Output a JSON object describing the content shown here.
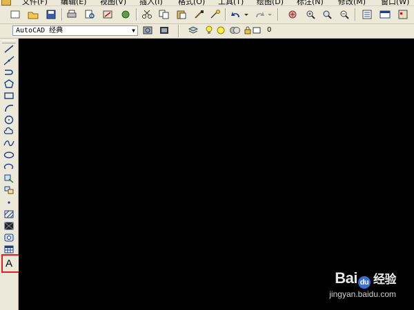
{
  "menubar": {
    "items": [
      "文件(F)",
      "编辑(E)",
      "视图(V)",
      "插入(I)",
      "格式(O)",
      "工具(T)",
      "绘图(D)",
      "标注(N)",
      "修改(M)",
      "窗口(W)"
    ]
  },
  "toolbar_standard": {
    "buttons": [
      "new-icon",
      "open-icon",
      "save-icon",
      "print-icon",
      "print-preview-icon",
      "publish-icon",
      "3d-dwf-icon",
      "cut-icon",
      "copy-icon",
      "paste-icon",
      "match-properties-icon",
      "block-editor-icon",
      "undo-icon",
      "redo-icon",
      "pan-icon",
      "zoom-realtime-icon",
      "zoom-window-icon",
      "zoom-previous-icon",
      "properties-icon",
      "design-center-icon"
    ]
  },
  "toolbar_workspace": {
    "workspace_value": "AutoCAD 经典",
    "layer_value": "0"
  },
  "draw_toolbar": {
    "tools": [
      "line-icon",
      "construction-line-icon",
      "polyline-icon",
      "polygon-icon",
      "rectangle-icon",
      "arc-icon",
      "circle-icon",
      "revision-cloud-icon",
      "spline-icon",
      "ellipse-icon",
      "ellipse-arc-icon",
      "insert-block-icon",
      "make-block-icon",
      "point-icon",
      "hatch-icon",
      "gradient-icon",
      "region-icon",
      "table-icon"
    ],
    "text_tool_label": "A",
    "highlight_color": "#e02020"
  },
  "canvas": {
    "background": "#000000"
  },
  "watermark": {
    "logo_prefix": "Bai",
    "logo_paw": "du",
    "logo_cn": "经验",
    "url": "jingyan.baidu.com"
  }
}
